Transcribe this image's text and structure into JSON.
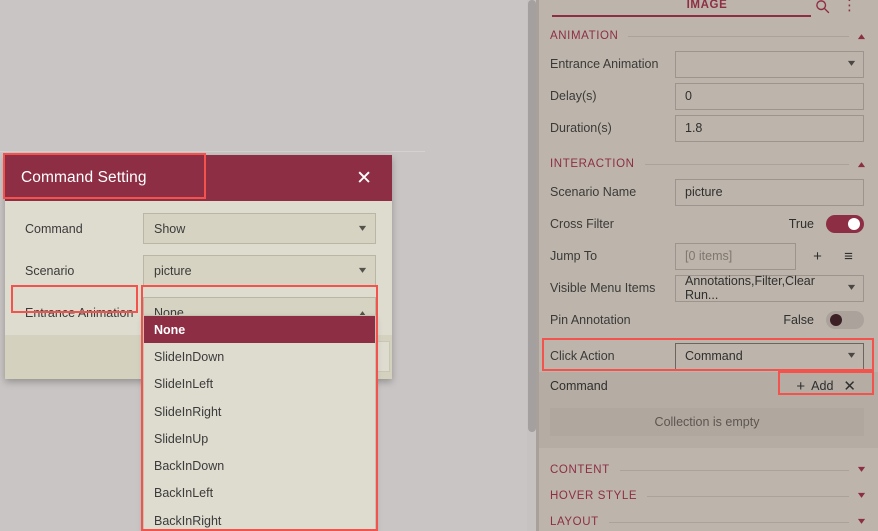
{
  "canvas": {
    "background_color": "#c9c5c5"
  },
  "dialog": {
    "title": "Command Setting",
    "close_label": "✕",
    "rows": [
      {
        "label": "Command",
        "value": "Show",
        "caret": "⌄"
      },
      {
        "label": "Scenario",
        "value": "picture",
        "caret": "⌄"
      },
      {
        "label": "Entrance Animation",
        "value": "None",
        "caret": "⌄"
      }
    ],
    "dropdown": {
      "selected": "None",
      "options": [
        "None",
        "SlideInDown",
        "SlideInLeft",
        "SlideInRight",
        "SlideInUp",
        "BackInDown",
        "BackInLeft",
        "BackInRight"
      ]
    }
  },
  "panel": {
    "tab_label": "IMAGE",
    "search_icon": "search-icon",
    "kebab_icon": "⋮",
    "sections": {
      "animation": {
        "title": "ANIMATION",
        "collapsed": false,
        "rows": [
          {
            "label": "Entrance Animation",
            "value": "",
            "type": "select"
          },
          {
            "label": "Delay(s)",
            "value": "0",
            "type": "input"
          },
          {
            "label": "Duration(s)",
            "value": "1.8",
            "type": "input"
          }
        ]
      },
      "interaction": {
        "title": "INTERACTION",
        "collapsed": false,
        "scenario_name": {
          "label": "Scenario Name",
          "value": "picture"
        },
        "cross_filter": {
          "label": "Cross Filter",
          "value": "True",
          "state": "on"
        },
        "jump_to": {
          "label": "Jump To",
          "placeholder": "[0 items]",
          "add_icon": "+",
          "list_icon": "≡"
        },
        "visible_menu_items": {
          "label": "Visible Menu Items",
          "value": "Annotations,Filter,Clear Run..."
        },
        "pin_annotation": {
          "label": "Pin Annotation",
          "value": "False",
          "state": "off"
        },
        "click_action": {
          "label": "Click Action",
          "value": "Command"
        },
        "command_collection": {
          "label": "Command",
          "add_label": "Add",
          "add_icon": "+",
          "close_icon": "✕",
          "empty_text": "Collection is empty"
        }
      },
      "content": {
        "title": "CONTENT",
        "collapsed": true
      },
      "hover_style": {
        "title": "HOVER STYLE",
        "collapsed": true
      },
      "layout": {
        "title": "LAYOUT",
        "collapsed": true
      }
    }
  },
  "colors": {
    "accent": "#8d2e44",
    "highlight": "#f4534d",
    "panel_bg": "#bdb5ac",
    "dialog_bg": "#dedbcf"
  }
}
